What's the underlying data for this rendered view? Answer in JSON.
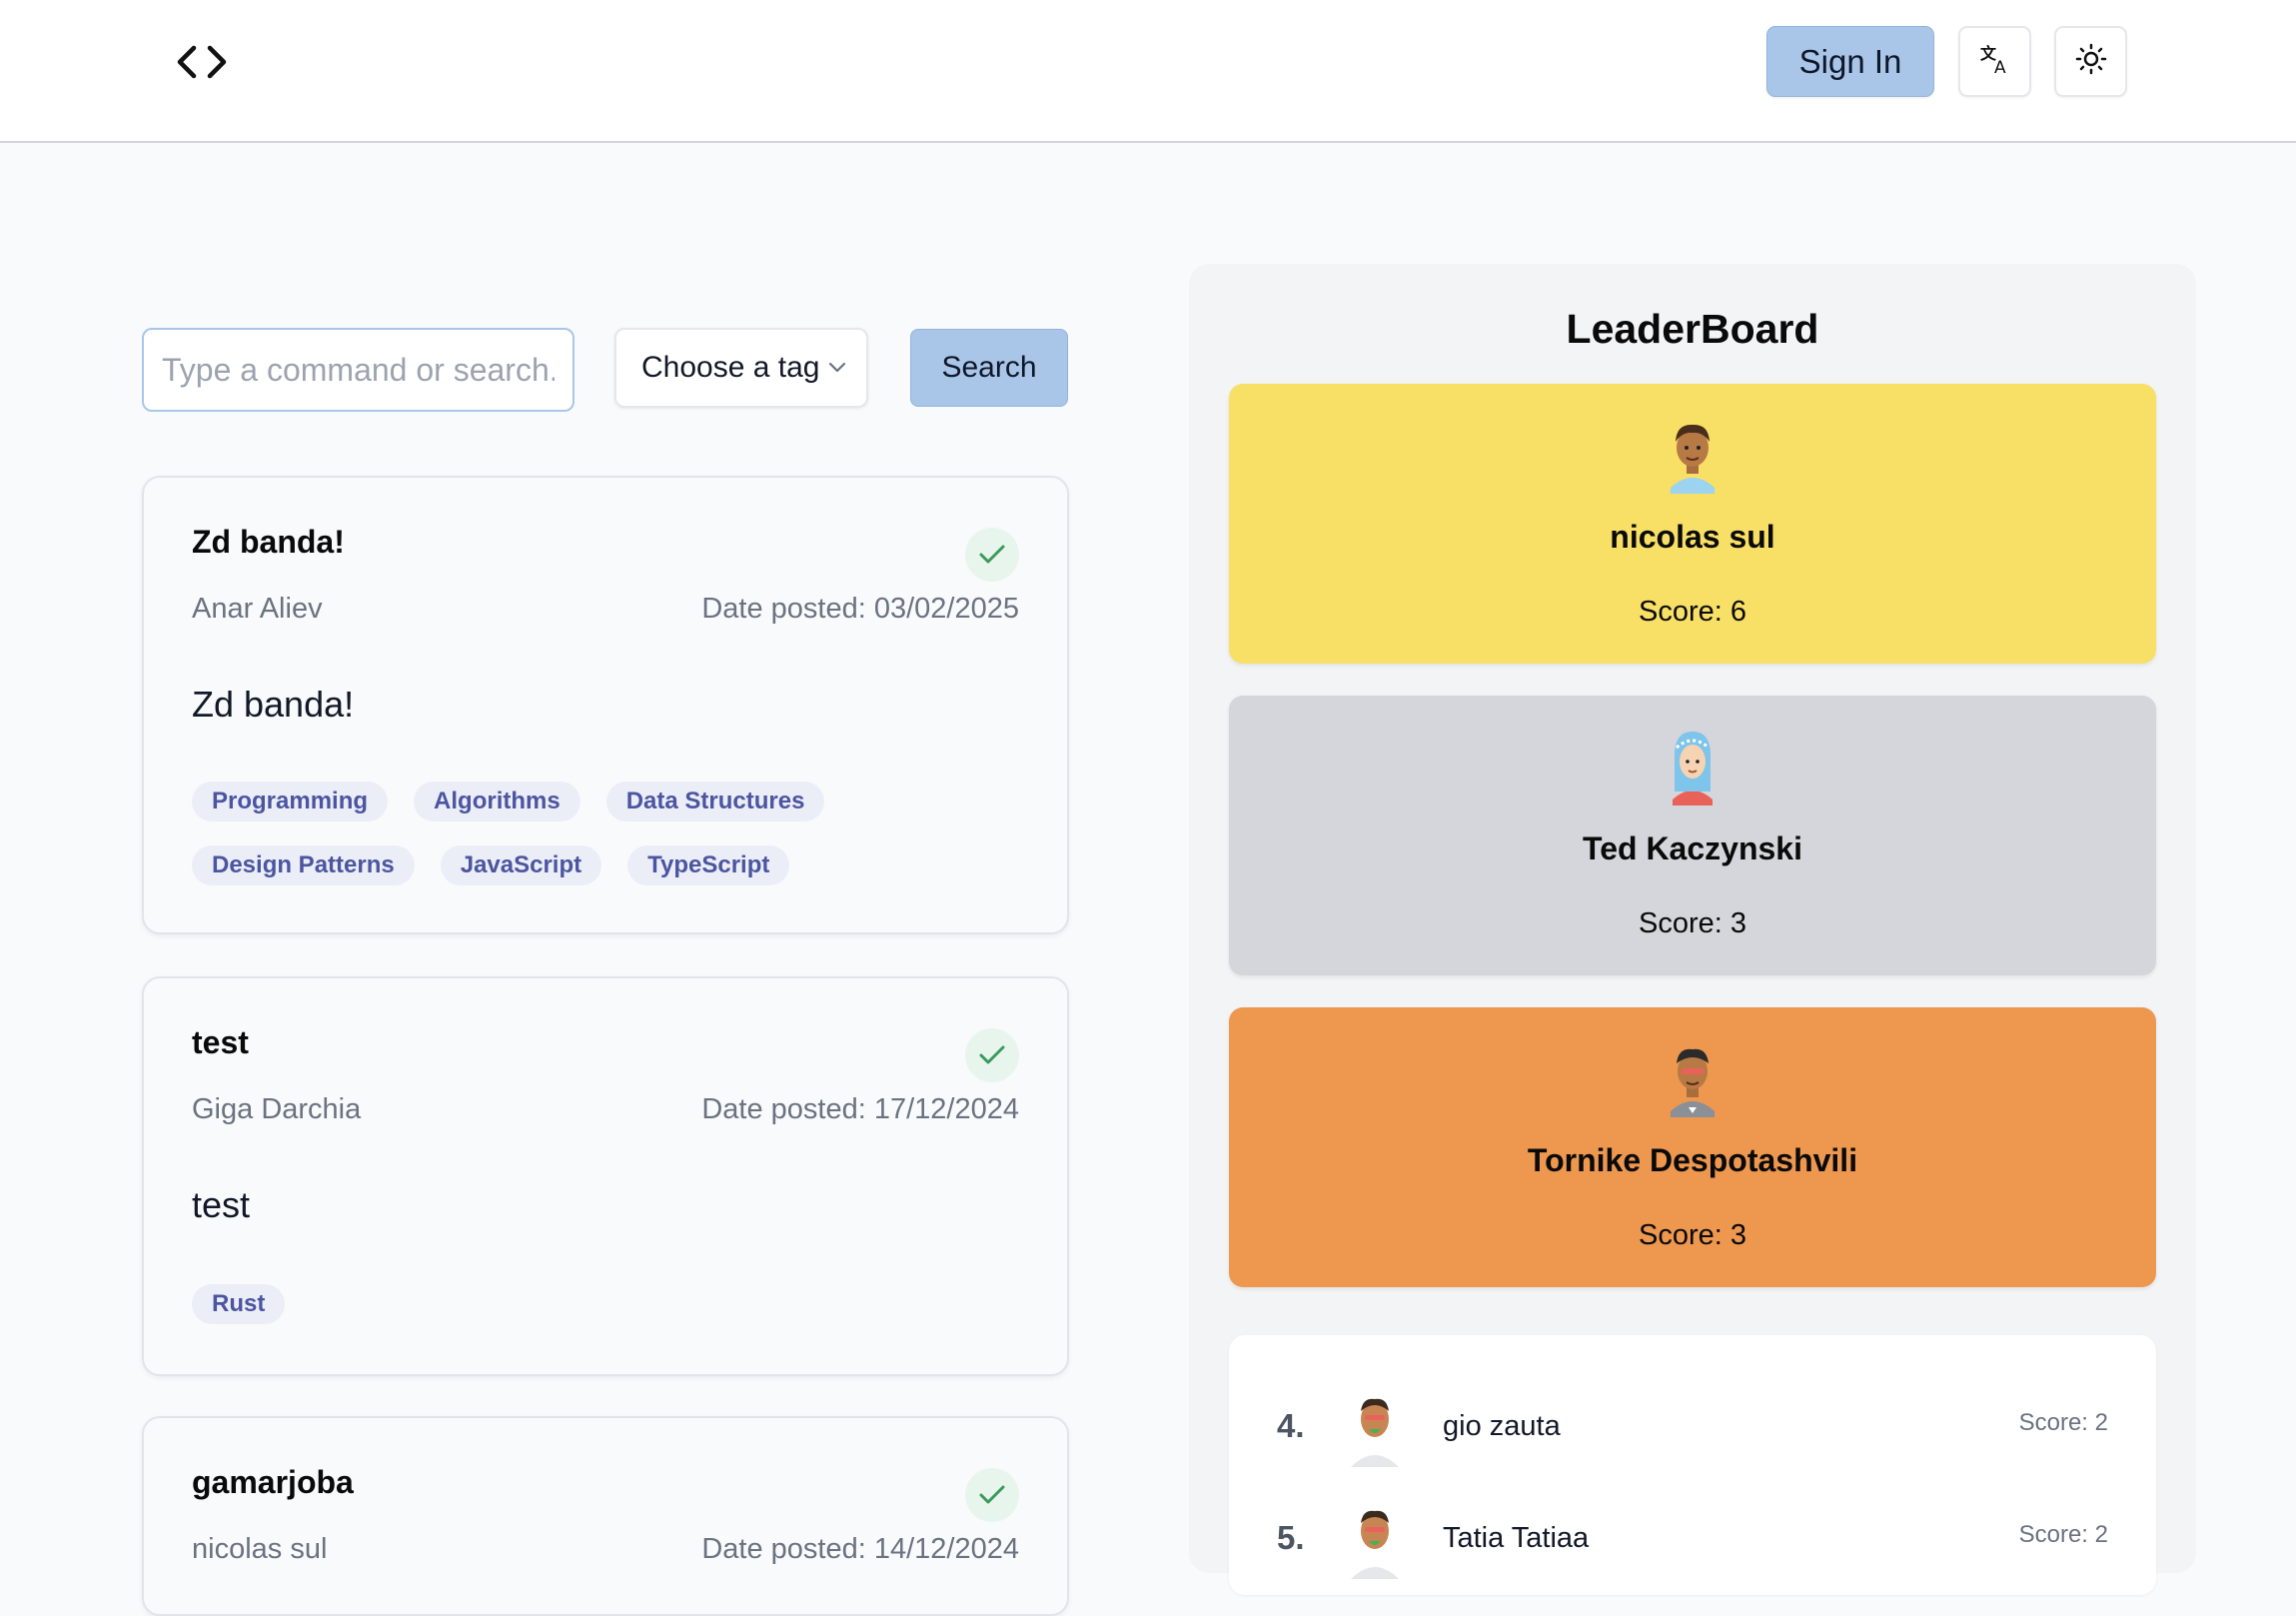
{
  "header": {
    "logo_icon": "code-brackets-icon",
    "sign_in_label": "Sign In",
    "translate_icon": "translate-icon",
    "theme_icon": "sun-icon"
  },
  "search": {
    "placeholder": "Type a command or search...",
    "tag_select_label": "Choose a tag",
    "button_label": "Search"
  },
  "posts": [
    {
      "title": "Zd banda!",
      "author": "Anar Aliev",
      "date": "Date posted: 03/02/2025",
      "body": "Zd banda!",
      "tags": [
        "Programming",
        "Algorithms",
        "Data Structures",
        "Design Patterns",
        "JavaScript",
        "TypeScript"
      ]
    },
    {
      "title": "test",
      "author": "Giga Darchia",
      "date": "Date posted: 17/12/2024",
      "body": "test",
      "tags": [
        "Rust"
      ]
    },
    {
      "title": "gamarjoba",
      "author": "nicolas sul",
      "date": "Date posted: 14/12/2024",
      "body": "",
      "tags": []
    }
  ],
  "leaderboard": {
    "title": "LeaderBoard",
    "podium": [
      {
        "name": "nicolas sul",
        "score": "Score: 6",
        "color": "#f8df66"
      },
      {
        "name": "Ted Kaczynski",
        "score": "Score: 3",
        "color": "#d4d6db"
      },
      {
        "name": "Tornike Despotashvili",
        "score": "Score: 3",
        "color": "#ee974f"
      }
    ],
    "list": [
      {
        "rank": "4.",
        "name": "gio zauta",
        "score": "Score: 2"
      },
      {
        "rank": "5.",
        "name": "Tatia Tatiaa",
        "score": "Score: 2"
      }
    ]
  },
  "colors": {
    "accent": "#a9c6e8",
    "tag_bg": "#eceef7",
    "tag_text": "#4b55a0",
    "check": "#3a9a5b"
  }
}
